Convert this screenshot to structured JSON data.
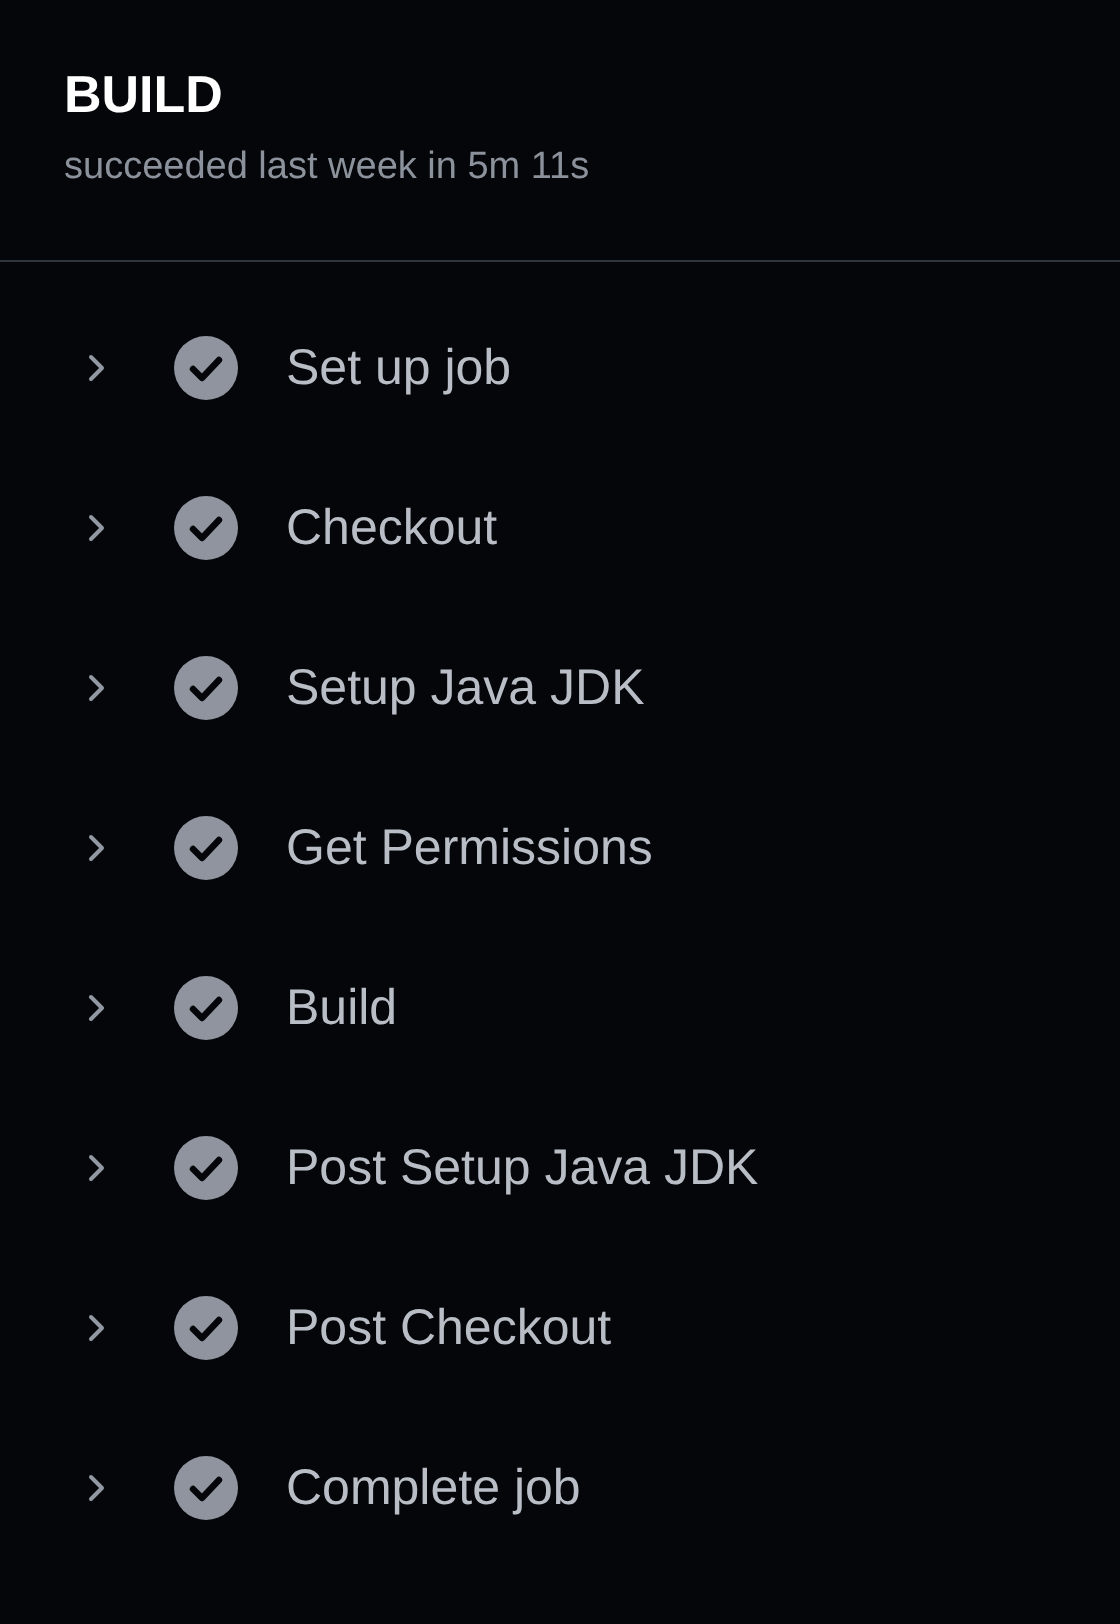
{
  "job": {
    "title": "BUILD",
    "summary": "succeeded last week in 5m 11s"
  },
  "steps": [
    {
      "label": "Set up job",
      "expanded": false,
      "kind": "success"
    },
    {
      "label": "Checkout",
      "expanded": false,
      "kind": "success"
    },
    {
      "label": "Setup Java JDK",
      "expanded": false,
      "kind": "success"
    },
    {
      "label": "Get Permissions",
      "expanded": false,
      "kind": "success"
    },
    {
      "label": "Build",
      "expanded": false,
      "kind": "success"
    },
    {
      "label": "Post Setup Java JDK",
      "expanded": false,
      "kind": "success"
    },
    {
      "label": "Post Checkout",
      "expanded": false,
      "kind": "success"
    },
    {
      "label": "Complete job",
      "expanded": false,
      "kind": "success"
    }
  ]
}
